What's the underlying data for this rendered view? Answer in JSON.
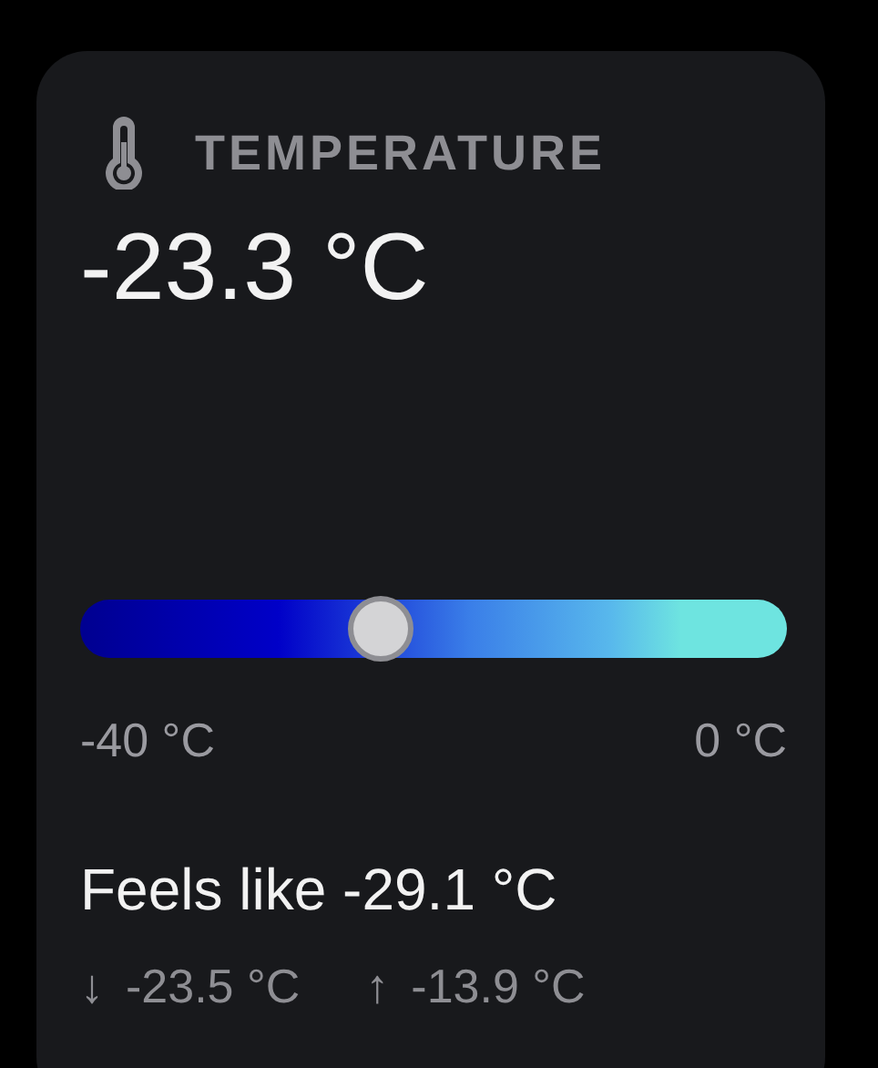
{
  "card": {
    "title": "TEMPERATURE",
    "value": "-23.3 °C",
    "slider": {
      "level": 0.426,
      "min_label": "-40 °C",
      "max_label": "0 °C"
    },
    "feels_like": "Feels like -29.1 °C",
    "low": {
      "arrow": "↓",
      "value": "-23.5 °C"
    },
    "high": {
      "arrow": "↑",
      "value": "-13.9 °C"
    }
  }
}
